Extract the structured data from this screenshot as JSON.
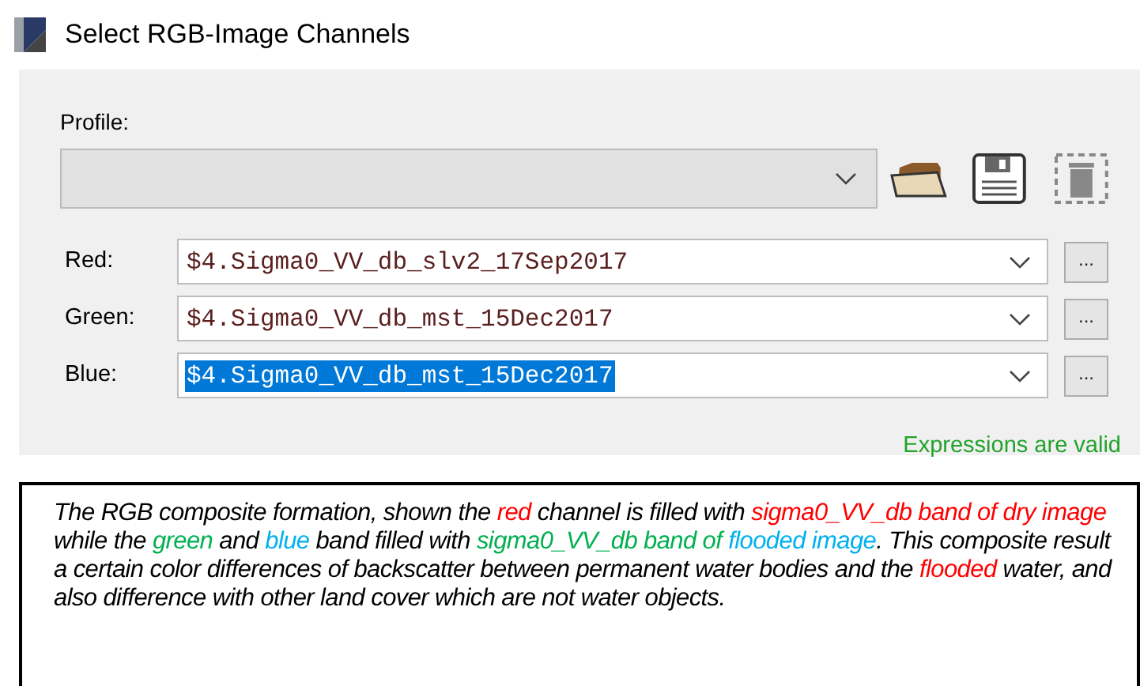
{
  "window": {
    "title": "Select RGB-Image Channels"
  },
  "profile": {
    "label": "Profile:",
    "disabled": true
  },
  "channels": [
    {
      "label": "Red:",
      "value": "$4.Sigma0_VV_db_slv2_17Sep2017",
      "selected": false,
      "button": "..."
    },
    {
      "label": "Green:",
      "value": "$4.Sigma0_VV_db_mst_15Dec2017",
      "selected": false,
      "button": "..."
    },
    {
      "label": "Blue:",
      "value": "$4.Sigma0_VV_db_mst_15Dec2017",
      "selected": true,
      "button": "..."
    }
  ],
  "status": "Expressions are valid",
  "caption": [
    {
      "text": "The RGB composite formation, shown the ",
      "color": "#000000"
    },
    {
      "text": "red",
      "color": "#ff0000"
    },
    {
      "text": " channel is filled with ",
      "color": "#000000"
    },
    {
      "text": "sigma0_VV_db band of dry image",
      "color": "#ff0000"
    },
    {
      "text": " while the ",
      "color": "#000000"
    },
    {
      "text": "green",
      "color": "#00b050"
    },
    {
      "text": " and ",
      "color": "#000000"
    },
    {
      "text": "blue",
      "color": "#00b0f0"
    },
    {
      "text": " band filled with ",
      "color": "#000000"
    },
    {
      "text": "sigma0_VV_db band of ",
      "color": "#00b050"
    },
    {
      "text": "flooded image",
      "color": "#00b0f0"
    },
    {
      "text": ". This composite result a certain color differences of backscatter between permanent water bodies and the ",
      "color": "#000000"
    },
    {
      "text": "flooded",
      "color": "#ff0000"
    },
    {
      "text": " water, and also difference with other land cover which are not water objects.",
      "color": "#000000"
    }
  ]
}
